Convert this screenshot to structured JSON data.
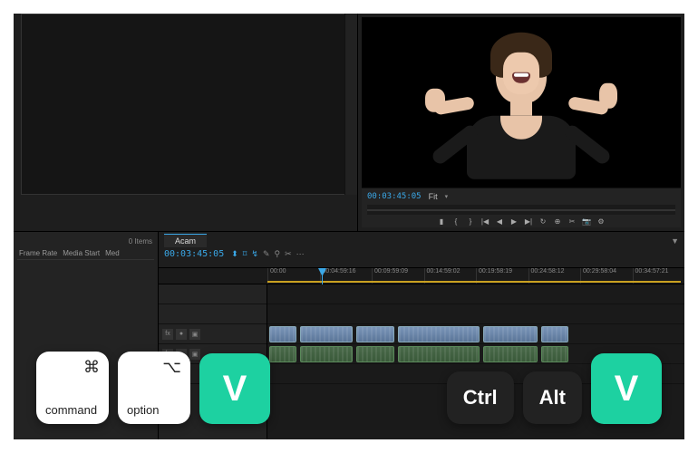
{
  "program": {
    "timecode": "00:03:45:05",
    "fit_label": "Fit",
    "dropdown_indicator": "▾",
    "transport": [
      "▮",
      "{",
      "}",
      "|◀",
      "◀",
      "▶",
      "▶|",
      "↻",
      "⊕",
      "✂",
      "📷",
      "⚙"
    ]
  },
  "project": {
    "items_count": "0 Items",
    "columns": [
      "Frame Rate",
      "Media Start",
      "Med"
    ]
  },
  "timeline": {
    "sequence_name": "Acam",
    "timecode": "00:03:45:05",
    "tool_icons": [
      "⬍",
      "⌑",
      "↯",
      "✎",
      "⚲",
      "✂",
      "⋯"
    ],
    "filter_icon": "▼",
    "ruler_marks": [
      "00:00",
      "00:04:59:16",
      "00:09:59:09",
      "00:14:59:02",
      "00:19:58:19",
      "00:24:58:12",
      "00:29:58:04",
      "00:34:57:21"
    ],
    "track_buttons": [
      "fx",
      "●",
      "▣"
    ]
  },
  "shortcuts": {
    "mac": {
      "command": {
        "symbol": "⌘",
        "label": "command"
      },
      "option": {
        "symbol": "⌥",
        "label": "option"
      },
      "v": "V"
    },
    "win": {
      "ctrl": "Ctrl",
      "alt": "Alt",
      "v": "V"
    }
  }
}
